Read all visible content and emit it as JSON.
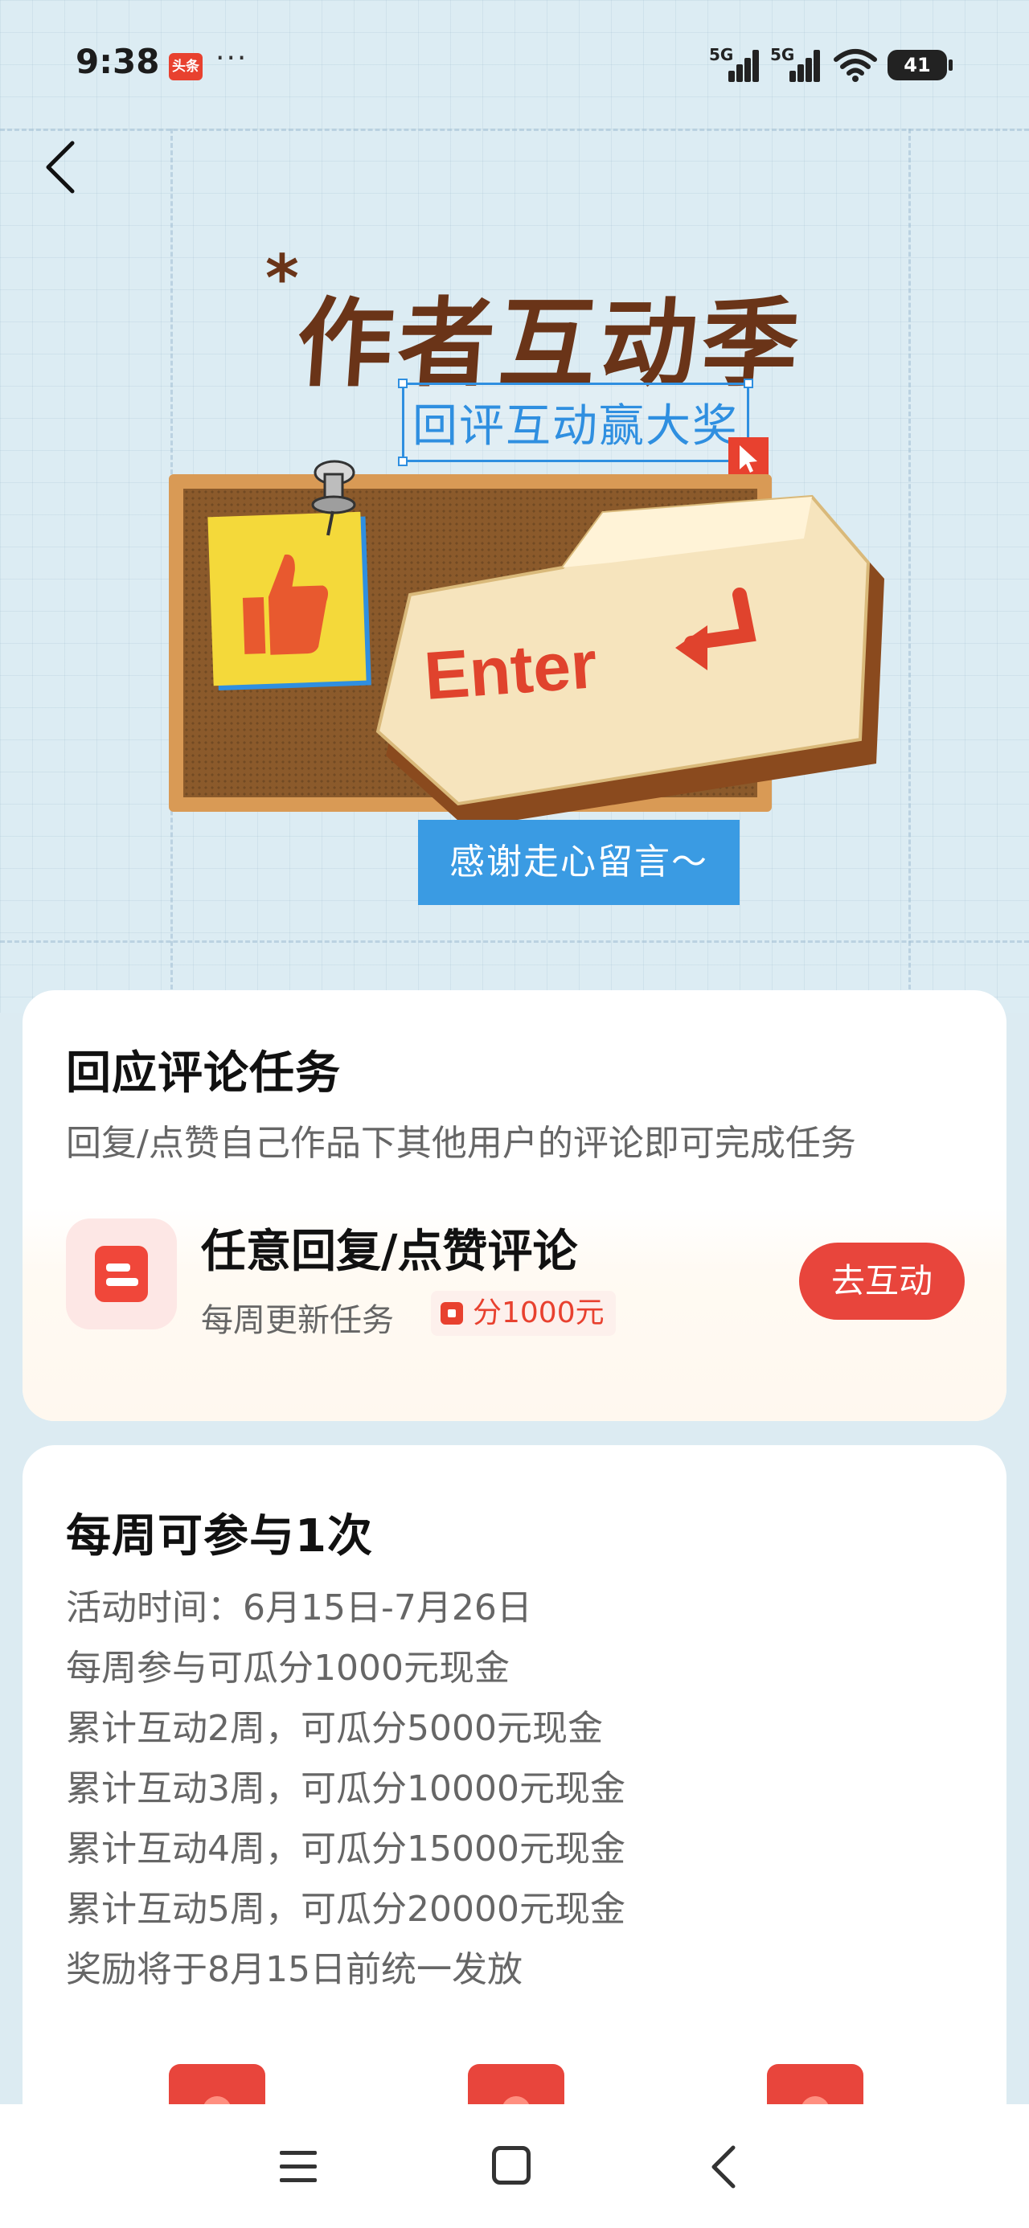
{
  "status_bar": {
    "time": "9:38",
    "app_badge": "头条",
    "more": "···",
    "signal_label_1": "5G",
    "signal_label_2": "5G",
    "battery": "41"
  },
  "banner": {
    "title": "作者互动季",
    "subtitle": "回评互动赢大奖",
    "key_label": "Enter",
    "ribbon": "感谢走心留言～"
  },
  "task_card": {
    "title": "回应评论任务",
    "description": "回复/点赞自己作品下其他用户的评论即可完成任务",
    "task": {
      "name": "任意回复/点赞评论",
      "meta": "每周更新任务",
      "reward": "分1000元",
      "button": "去互动"
    }
  },
  "rules_card": {
    "title": "每周可参与1次",
    "lines": [
      "活动时间：6月15日-7月26日",
      "每周参与可瓜分1000元现金",
      "累计互动2周，可瓜分5000元现金",
      "累计互动3周，可瓜分10000元现金",
      "累计互动4周，可瓜分15000元现金",
      "累计互动5周，可瓜分20000元现金",
      "奖励将于8月15日前统一发放"
    ]
  },
  "colors": {
    "accent": "#e8453c",
    "title_brown": "#6a3418",
    "highlight_blue": "#2f8fe0",
    "background": "#dcebf2"
  },
  "icons": {
    "back": "back-arrow-icon",
    "task": "document-icon",
    "reward": "red-packet-icon",
    "nav_menu": "menu-icon",
    "nav_home": "home-icon",
    "nav_back": "back-icon"
  }
}
